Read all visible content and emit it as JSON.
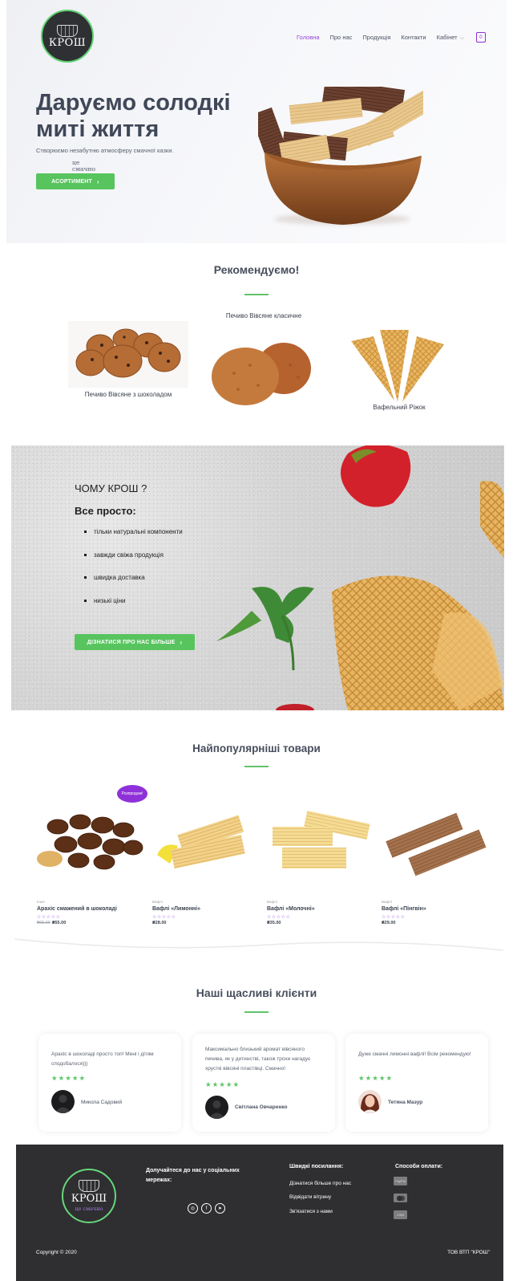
{
  "header": {
    "logo": {
      "brand": "КРОШ",
      "tagline": "це смачно"
    },
    "nav": [
      {
        "label": "Головна",
        "active": true
      },
      {
        "label": "Про нас"
      },
      {
        "label": "Продукція"
      },
      {
        "label": "Контакти"
      },
      {
        "label": "Кабінет"
      }
    ],
    "cart_count": "0"
  },
  "hero": {
    "title": "Даруємо солодкі миті життя",
    "subtitle": "Створюємо незабутню атмосферу смачної казки.",
    "button": "АСОРТИМЕНТ"
  },
  "recommended": {
    "title": "Рекомендуємо!",
    "items": [
      {
        "label": "Печиво Вівсяне з шоколадом"
      },
      {
        "label": "Печиво Вівсяне класичне"
      },
      {
        "label": "Вафельний Ріжок"
      }
    ]
  },
  "why": {
    "title": "ЧОМУ КРОШ ?",
    "subtitle": "Все просто:",
    "points": [
      "тільки натуральні компоненти",
      "завжди свіжа продукція",
      "швидка доставка",
      "низькі ціни"
    ],
    "button": "ДІЗНАТИСЯ ПРО НАС БІЛЬШЕ"
  },
  "popular": {
    "title": "Найпопулярніші товари",
    "badge": "Розпродаж!",
    "products": [
      {
        "category": "Інше",
        "name": "Арахіс смажений в шоколаді",
        "old_price": "₴65.00",
        "price": "₴55.00",
        "stars": "☆☆☆☆☆"
      },
      {
        "category": "Вафлі",
        "name": "Вафлі «Лимонні»",
        "price": "₴28.00",
        "stars": "☆☆☆☆☆"
      },
      {
        "category": "Вафлі",
        "name": "Вафлі «Молочні»",
        "price": "₴35.00",
        "stars": "☆☆☆☆☆"
      },
      {
        "category": "Вафлі",
        "name": "Вафлі «Пінгвін»",
        "price": "₴29.00",
        "stars": "☆☆☆☆☆"
      }
    ]
  },
  "clients": {
    "title": "Наші щасливі клієнти",
    "reviews": [
      {
        "text": "Арахіс в шоколаді просто топ! Мені і дітям сподобалося)))",
        "stars": "★★★★★",
        "name": "Микола Садовий"
      },
      {
        "text": "Максимально близький аромат вівсяного печива, як у дитинстві, також трохи нагадує хрусткі вівсяні пластівці. Смачно!",
        "stars": "★★★★★",
        "name": "Світлана Овчаренко"
      },
      {
        "text": "Дуже смачні лимонні вафлі! Всім рекомендую!",
        "stars": "★★★★★",
        "name": "Тетяна Мазур"
      }
    ]
  },
  "footer": {
    "logo": {
      "brand": "КРОШ",
      "tagline": "це смачно"
    },
    "social_heading": "Долучайтеся до нас у соціальних мережах:",
    "social": [
      {
        "icon": "instagram-icon",
        "glyph": "◎"
      },
      {
        "icon": "facebook-icon",
        "glyph": "f"
      },
      {
        "icon": "telegram-icon",
        "glyph": "➤"
      }
    ],
    "links_heading": "Швидкі посилання:",
    "links": [
      "Дізнатися більше про нас",
      "Відвідати вітрину",
      "Зв'язатися з нами"
    ],
    "payment_heading": "Способи оплати:",
    "payments": [
      "PayPal",
      "",
      "VISA"
    ],
    "copyright": "Copyright © 2020",
    "company": "ТОВ ВТП \"КРОШ\""
  }
}
